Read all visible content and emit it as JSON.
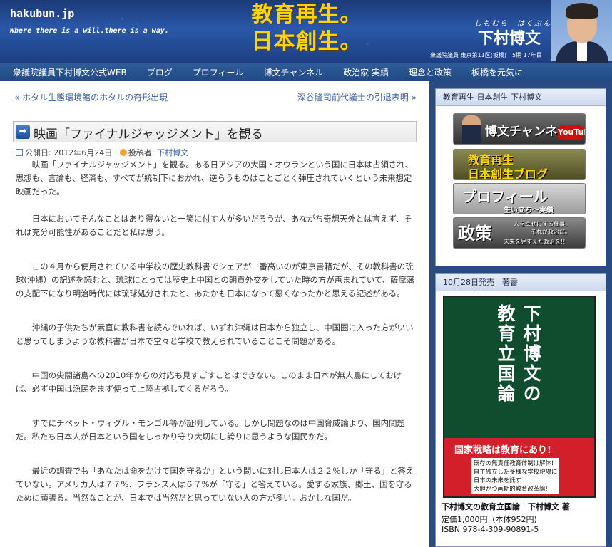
{
  "header": {
    "site_name": "hakubun.jp",
    "tagline": "Where there is a will.there is a way.",
    "slogan_line1": "教育再生。",
    "slogan_line2": "日本創生。",
    "name_ruby": "しもむら　はくぶん",
    "name": "下村博文",
    "name_sub": "衆議院議員 東京第11区(板橋)　5期 17年目"
  },
  "nav": {
    "items": [
      "衆議院議員下村博文公式WEB",
      "ブログ",
      "プロフィール",
      "博文チャンネル",
      "政治家 実績",
      "理念と政策",
      "板橋を元気に"
    ]
  },
  "post": {
    "prev_link": "« ホタル生態環境館のホタルの奇形出現",
    "next_link": "深谷隆司前代議士の引退表明 »",
    "title": "映画「ファイナルジャッジメント」を観る",
    "date_label": "公開日: 2012年6月24日",
    "separator": "|",
    "author_label": "投稿者:",
    "author": "下村博文",
    "paragraphs": [
      "映画「ファイナルジャッジメント」を観る。ある日アジアの大国・オウランという国に日本は占領され、思想も、言論も、経済も、すべてが統制下におかれ、逆らうものはことごとく弾圧されていくという未来想定映画だった。",
      "日本においてそんなことはあり得ないと一笑に付す人が多いだろうが、あながち奇想天外とは言えず、それは充分可能性があることだと私は思う。",
      "この４月から使用されている中学校の歴史教科書でシェアが一番高いのが東京書籍だが、その教科書の琉球(沖縄）の記述を読むと、琉球にとっては歴史上中国との朝貢外交をしていた時の方が恵まれていて、薩摩藩の支配下になり明治時代には琉球処分されたと、あたかも日本になって悪くなったかと思える記述がある。",
      "沖縄の子供たちが素直に教科書を読んでいれば、いずれ沖縄は日本から独立し、中国圏に入った方がいいと思ってしまうような教科書が日本で堂々と学校で教えられていることこそ問題がある。",
      "中国の尖閣諸島への2010年からの対応も見すごすことはできない。このまま日本が無人島にしておけば、必ず中国は漁民をまず使って上陸占拠してくるだろう。",
      "すでにチベット・ウィグル・モンゴル等が証明している。しかし問題なのは中国脅威論より、国内問題だ。私たち日本人が日本という国をしっかり守り大切にし誇りに思うような国民かだ。",
      "最近の調査でも「あなたは命をかけて国を守るか」という問いに対し日本人は２２％しか「守る」と答えていない。アメリカ人は７７%、フランス人は６７%が「守る」と答えている。愛する家族、郷土、国を守るために頑張る。当然なことが、日本では当然だと思っていない人の方が多い。おかしな国だ。"
    ]
  },
  "sidebar": {
    "widget1_title": "教育再生 日本創生 下村博文",
    "banners": {
      "channel": "博文チャンネル",
      "youtube": "YouTube",
      "blog_line1": "教育再生",
      "blog_line2": "日本創生ブログ",
      "profile": "プロフィール",
      "profile_sub": "生い立ち～実績",
      "policy": "政策",
      "policy_sub1": "人を幸せにする仕事、",
      "policy_sub2": "それが政治だ。",
      "policy_sub3": "未来を見すえた政治を!!"
    },
    "widget2_title": "10月28日発売　著書",
    "book": {
      "cover_title_col1": "下村博文の",
      "cover_title_col2": "教育立国論",
      "cover_slogan": "国家戦略は教育にあり!",
      "cover_copy1": "既存の無責任教育体制は解体!",
      "cover_copy2": "自主独立した多様な学校現場に",
      "cover_copy3": "日本の未来を託す",
      "cover_copy4": "大胆かつ画期的教育改革論!",
      "caption": "下村博文の教育立国論　下村博文 著",
      "price": "定価1,000円（本体952円)",
      "isbn": "ISBN 978-4-309-90891-5"
    }
  },
  "colors": {
    "header_bg": "#1c3a78",
    "nav_bg": "#2e5b9a",
    "link": "#3a62a8",
    "sidebar_bg": "#2a4a82",
    "slogan": "#ffd400",
    "book_green": "#0f4d2e",
    "book_red": "#d21f2a"
  }
}
